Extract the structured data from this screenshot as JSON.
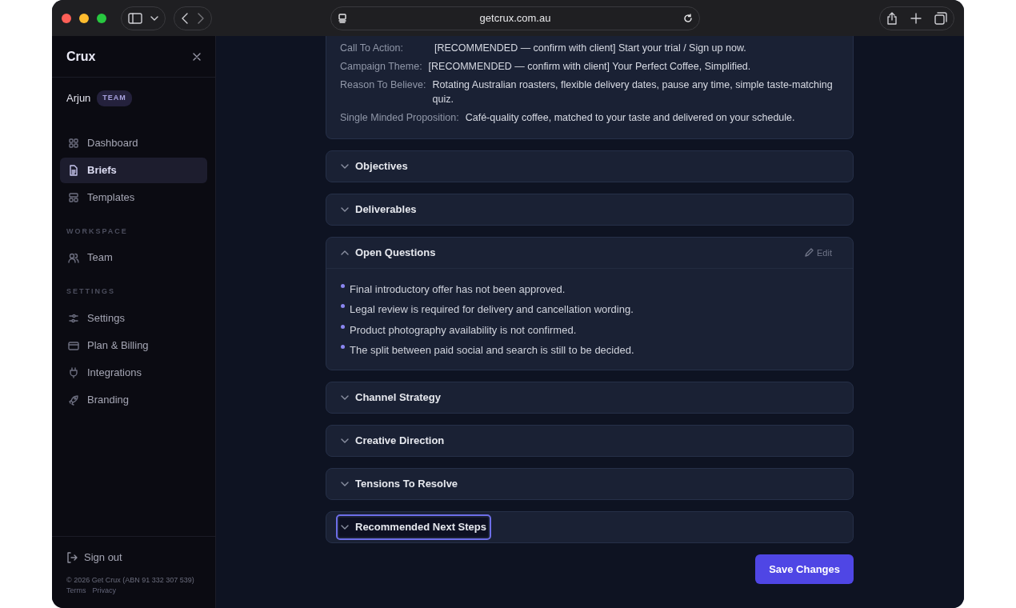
{
  "browser": {
    "url": "getcrux.com.au"
  },
  "sidebar": {
    "brand": "Crux",
    "user": {
      "name": "Arjun",
      "badge": "TEAM"
    },
    "groups": [
      {
        "items": [
          {
            "label": "Dashboard",
            "selected": false
          },
          {
            "label": "Briefs",
            "selected": true
          },
          {
            "label": "Templates",
            "selected": false
          }
        ]
      },
      {
        "heading": "WORKSPACE",
        "items": [
          {
            "label": "Team",
            "selected": false
          }
        ]
      },
      {
        "heading": "SETTINGS",
        "items": [
          {
            "label": "Settings",
            "selected": false
          },
          {
            "label": "Plan & Billing",
            "selected": false
          },
          {
            "label": "Integrations",
            "selected": false
          },
          {
            "label": "Branding",
            "selected": false
          }
        ]
      }
    ],
    "sign_out": "Sign out",
    "copyright": "© 2026 Get Crux (ABN 91 332 307 539)",
    "links": [
      "Terms",
      "Privacy"
    ]
  },
  "brief": {
    "fields": [
      {
        "label": "Call To Action:",
        "value": "[RECOMMENDED — confirm with client] Start your trial / Sign up now."
      },
      {
        "label": "Campaign Theme:",
        "value": "[RECOMMENDED — confirm with client] Your Perfect Coffee, Simplified."
      },
      {
        "label": "Reason To Believe:",
        "value": "Rotating Australian roasters, flexible delivery dates, pause any time, simple taste-matching quiz."
      },
      {
        "label": "Single Minded Proposition:",
        "value": "Café-quality coffee, matched to your taste and delivered on your schedule."
      }
    ],
    "sections": [
      {
        "title": "Objectives",
        "expanded": false,
        "focused": false
      },
      {
        "title": "Deliverables",
        "expanded": false,
        "focused": false
      },
      {
        "title": "Open Questions",
        "expanded": true,
        "focused": false,
        "edit_label": "Edit",
        "items": [
          "Final introductory offer has not been approved.",
          "Legal review is required for delivery and cancellation wording.",
          "Product photography availability is not confirmed.",
          "The split between paid social and search is still to be decided."
        ]
      },
      {
        "title": "Channel Strategy",
        "expanded": false,
        "focused": false
      },
      {
        "title": "Creative Direction",
        "expanded": false,
        "focused": false
      },
      {
        "title": "Tensions To Resolve",
        "expanded": false,
        "focused": false
      },
      {
        "title": "Recommended Next Steps",
        "expanded": false,
        "focused": true
      }
    ]
  },
  "save_button": "Save Changes"
}
